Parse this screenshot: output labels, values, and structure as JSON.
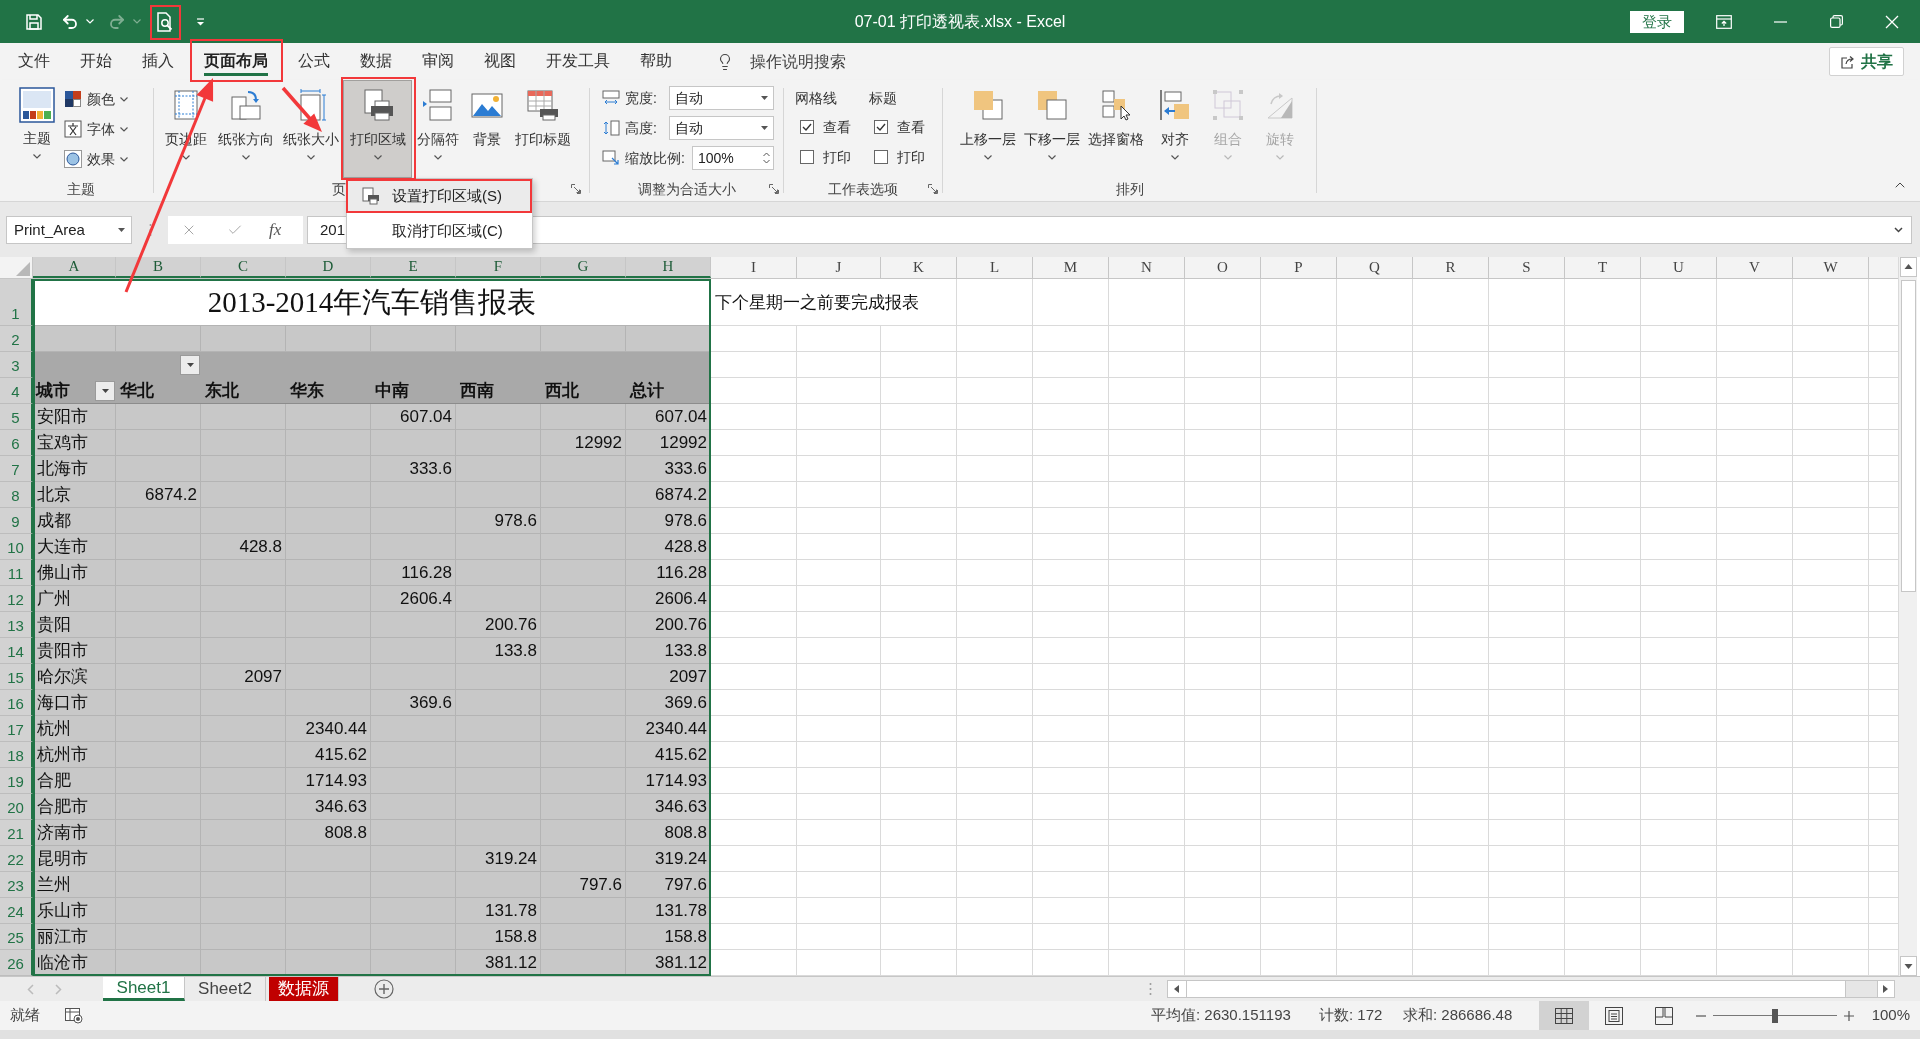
{
  "title_bar": {
    "quick_access": [
      {
        "kind": "save",
        "disabled": false
      },
      {
        "kind": "undo",
        "disabled": false
      },
      {
        "kind": "redo",
        "disabled": true
      },
      {
        "kind": "print_preview",
        "disabled": false
      }
    ],
    "title": "07-01 打印透视表.xlsx - Excel",
    "sign_in": "登录"
  },
  "menu_tabs": [
    {
      "label": "文件",
      "selected": false
    },
    {
      "label": "开始",
      "selected": false
    },
    {
      "label": "插入",
      "selected": false
    },
    {
      "label": "页面布局",
      "selected": true
    },
    {
      "label": "公式",
      "selected": false
    },
    {
      "label": "数据",
      "selected": false
    },
    {
      "label": "审阅",
      "selected": false
    },
    {
      "label": "视图",
      "selected": false
    },
    {
      "label": "开发工具",
      "selected": false
    },
    {
      "label": "帮助",
      "selected": false
    }
  ],
  "tell_me": "操作说明搜索",
  "share": "共享",
  "ribbon": {
    "groups": [
      {
        "kind": "themes",
        "label": "主题",
        "launcher": false,
        "main": {
          "label": "主题"
        },
        "options": [
          {
            "kind": "colors",
            "label": "颜色"
          },
          {
            "kind": "fonts",
            "label": "字体"
          },
          {
            "kind": "effects",
            "label": "效果"
          }
        ]
      },
      {
        "kind": "page_setup",
        "label": "页",
        "launcher": true,
        "buttons": [
          {
            "kind": "margins",
            "label": "页边距",
            "pressed": false,
            "dropdown": true
          },
          {
            "kind": "orientation",
            "label": "纸张方向",
            "pressed": false,
            "dropdown": true
          },
          {
            "kind": "size",
            "label": "纸张大小",
            "pressed": false,
            "dropdown": true
          },
          {
            "kind": "print_area",
            "label": "打印区域",
            "pressed": true,
            "dropdown": true
          },
          {
            "kind": "breaks",
            "label": "分隔符",
            "pressed": false,
            "dropdown": true
          },
          {
            "kind": "background",
            "label": "背景",
            "pressed": false,
            "dropdown": false
          },
          {
            "kind": "print_titles",
            "label": "打印标题",
            "pressed": false,
            "dropdown": false
          }
        ]
      },
      {
        "kind": "scale_to_fit",
        "label": "调整为合适大小",
        "launcher": true,
        "fields": [
          {
            "kind": "width",
            "label": "宽度:",
            "value": "自动"
          },
          {
            "kind": "height",
            "label": "高度:",
            "value": "自动"
          },
          {
            "kind": "scale",
            "label": "缩放比例:",
            "value": "100%"
          }
        ]
      },
      {
        "kind": "sheet_options",
        "label": "工作表选项",
        "launcher": true,
        "sections": [
          {
            "heading": "网格线",
            "options": [
              {
                "label": "查看",
                "checked": true
              },
              {
                "label": "打印",
                "checked": false
              }
            ]
          },
          {
            "heading": "标题",
            "options": [
              {
                "label": "查看",
                "checked": true
              },
              {
                "label": "打印",
                "checked": false
              }
            ]
          }
        ]
      },
      {
        "kind": "arrange",
        "label": "排列",
        "launcher": false,
        "buttons": [
          {
            "kind": "bring_forward",
            "label": "上移一层",
            "disabled": false,
            "dropdown": true
          },
          {
            "kind": "send_backward",
            "label": "下移一层",
            "disabled": false,
            "dropdown": true
          },
          {
            "kind": "selection_pane",
            "label": "选择窗格",
            "disabled": false,
            "dropdown": false
          },
          {
            "kind": "align",
            "label": "对齐",
            "disabled": false,
            "dropdown": true
          },
          {
            "kind": "group",
            "label": "组合",
            "disabled": true,
            "dropdown": true
          },
          {
            "kind": "rotate",
            "label": "旋转",
            "disabled": true,
            "dropdown": true
          }
        ]
      }
    ]
  },
  "print_area_menu": {
    "items": [
      {
        "kind": "set_print_area",
        "label": "设置打印区域(S)",
        "selected": true
      },
      {
        "kind": "clear_print_area",
        "label": "取消打印区域(C)",
        "selected": false
      }
    ]
  },
  "formula_bar": {
    "name_box": "Print_Area",
    "function_label": "fx",
    "formula": "201"
  },
  "sheet": {
    "columns": [
      {
        "label": "A",
        "selected": true
      },
      {
        "label": "B",
        "selected": true
      },
      {
        "label": "C",
        "selected": true
      },
      {
        "label": "D",
        "selected": true
      },
      {
        "label": "E",
        "selected": true
      },
      {
        "label": "F",
        "selected": true
      },
      {
        "label": "G",
        "selected": true
      },
      {
        "label": "H",
        "selected": true
      },
      {
        "label": "I",
        "selected": false
      },
      {
        "label": "J",
        "selected": false
      },
      {
        "label": "K",
        "selected": false
      },
      {
        "label": "L",
        "selected": false
      },
      {
        "label": "M",
        "selected": false
      },
      {
        "label": "N",
        "selected": false
      },
      {
        "label": "O",
        "selected": false
      },
      {
        "label": "P",
        "selected": false
      },
      {
        "label": "Q",
        "selected": false
      },
      {
        "label": "R",
        "selected": false
      },
      {
        "label": "S",
        "selected": false
      },
      {
        "label": "T",
        "selected": false
      },
      {
        "label": "U",
        "selected": false
      },
      {
        "label": "V",
        "selected": false
      },
      {
        "label": "W",
        "selected": false
      }
    ],
    "rows": [
      {
        "label": "1",
        "selected": true
      },
      {
        "label": "2",
        "selected": true
      },
      {
        "label": "3",
        "selected": true
      },
      {
        "label": "4",
        "selected": true
      },
      {
        "label": "5",
        "selected": true
      },
      {
        "label": "6",
        "selected": true
      },
      {
        "label": "7",
        "selected": true
      },
      {
        "label": "8",
        "selected": true
      },
      {
        "label": "9",
        "selected": true
      },
      {
        "label": "10",
        "selected": true
      },
      {
        "label": "11",
        "selected": true
      },
      {
        "label": "12",
        "selected": true
      },
      {
        "label": "13",
        "selected": true
      },
      {
        "label": "14",
        "selected": true
      },
      {
        "label": "15",
        "selected": true
      },
      {
        "label": "16",
        "selected": true
      },
      {
        "label": "17",
        "selected": true
      },
      {
        "label": "18",
        "selected": true
      },
      {
        "label": "19",
        "selected": true
      },
      {
        "label": "20",
        "selected": true
      },
      {
        "label": "21",
        "selected": true
      },
      {
        "label": "22",
        "selected": true
      },
      {
        "label": "23",
        "selected": true
      },
      {
        "label": "24",
        "selected": true
      },
      {
        "label": "25",
        "selected": true
      },
      {
        "label": "26",
        "selected": true
      }
    ],
    "title": "2013-2014年汽车销售报表",
    "note": "下个星期一之前要完成报表",
    "pivot": {
      "headers": [
        "城市",
        "华北",
        "东北",
        "华东",
        "中南",
        "西南",
        "西北",
        "总计"
      ],
      "rows": [
        {
          "city": "安阳市",
          "central_south": "607.04",
          "total": "607.04"
        },
        {
          "city": "宝鸡市",
          "northwest": "12992",
          "total": "12992"
        },
        {
          "city": "北海市",
          "central_south": "333.6",
          "total": "333.6"
        },
        {
          "city": "北京",
          "north_china": "6874.2",
          "total": "6874.2"
        },
        {
          "city": "成都",
          "southwest": "978.6",
          "total": "978.6"
        },
        {
          "city": "大连市",
          "northeast": "428.8",
          "total": "428.8"
        },
        {
          "city": "佛山市",
          "central_south": "116.28",
          "total": "116.28"
        },
        {
          "city": "广州",
          "central_south": "2606.4",
          "total": "2606.4"
        },
        {
          "city": "贵阳",
          "southwest": "200.76",
          "total": "200.76"
        },
        {
          "city": "贵阳市",
          "southwest": "133.8",
          "total": "133.8"
        },
        {
          "city": "哈尔滨",
          "northeast": "2097",
          "total": "2097"
        },
        {
          "city": "海口市",
          "central_south": "369.6",
          "total": "369.6"
        },
        {
          "city": "杭州",
          "east_china": "2340.44",
          "total": "2340.44"
        },
        {
          "city": "杭州市",
          "east_china": "415.62",
          "total": "415.62"
        },
        {
          "city": "合肥",
          "east_china": "1714.93",
          "total": "1714.93"
        },
        {
          "city": "合肥市",
          "east_china": "346.63",
          "total": "346.63"
        },
        {
          "city": "济南市",
          "east_china": "808.8",
          "total": "808.8"
        },
        {
          "city": "昆明市",
          "southwest": "319.24",
          "total": "319.24"
        },
        {
          "city": "兰州",
          "northwest": "797.6",
          "total": "797.6"
        },
        {
          "city": "乐山市",
          "southwest": "131.78",
          "total": "131.78"
        },
        {
          "city": "丽江市",
          "southwest": "158.8",
          "total": "158.8"
        },
        {
          "city": "临沧市",
          "southwest": "381.12",
          "total": "381.12"
        }
      ]
    }
  },
  "sheet_tabs": [
    {
      "label": "Sheet1",
      "selected": true
    },
    {
      "label": "Sheet2",
      "selected": false
    },
    {
      "label": "数据源",
      "selected": false,
      "color": "#c00000"
    }
  ],
  "status_bar": {
    "status": "就绪",
    "stats": [
      "平均值: 2630.151193",
      "计数: 172",
      "求和: 286686.48"
    ],
    "views": [
      {
        "kind": "normal",
        "selected": true
      },
      {
        "kind": "page_layout",
        "selected": false
      },
      {
        "kind": "page_break",
        "selected": false
      }
    ],
    "zoom": {
      "level": 0.5,
      "reading": "100%"
    }
  }
}
